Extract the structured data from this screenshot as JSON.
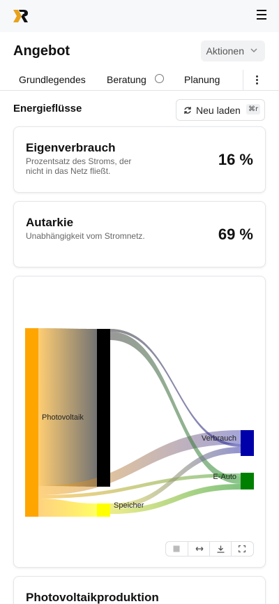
{
  "page": {
    "title": "Angebot",
    "actions_label": "Aktionen"
  },
  "tabs": [
    "Grundlegendes",
    "Beratung",
    "Planung"
  ],
  "section": {
    "title": "Energieflüsse",
    "reload_label": "Neu laden",
    "shortcut": "⌘r"
  },
  "kpis": [
    {
      "title": "Eigenverbrauch",
      "description": "Prozentsatz des Stroms, der nicht in das Netz fließt.",
      "value": "16 %"
    },
    {
      "title": "Autarkie",
      "description": "Unabhängigkeit vom Stromnetz.",
      "value": "69 %"
    }
  ],
  "chart_data": {
    "type": "sankey",
    "nodes": [
      {
        "name": "Photovoltaik",
        "color": "#FFA500"
      },
      {
        "name": "",
        "color": "#000000"
      },
      {
        "name": "Speicher",
        "color": "#FFFF00"
      },
      {
        "name": "Verbrauch",
        "color": "#0000AA"
      },
      {
        "name": "E-Auto",
        "color": "#008000"
      }
    ],
    "links": [
      {
        "source": "Photovoltaik",
        "target": "",
        "value": 84
      },
      {
        "source": "Photovoltaik",
        "target": "Verbrauch",
        "value": 5
      },
      {
        "source": "Photovoltaik",
        "target": "E-Auto",
        "value": 2
      },
      {
        "source": "Photovoltaik",
        "target": "Speicher",
        "value": 7
      },
      {
        "source": "",
        "target": "Verbrauch",
        "value": 1
      },
      {
        "source": "",
        "target": "E-Auto",
        "value": 2
      },
      {
        "source": "Speicher",
        "target": "Verbrauch",
        "value": 2
      },
      {
        "source": "Speicher",
        "target": "E-Auto",
        "value": 2
      }
    ]
  },
  "chart_tools": [
    "stop-icon",
    "swap-icon",
    "download-icon",
    "fullscreen-icon"
  ],
  "next_section": {
    "title": "Photovoltaikproduktion"
  }
}
